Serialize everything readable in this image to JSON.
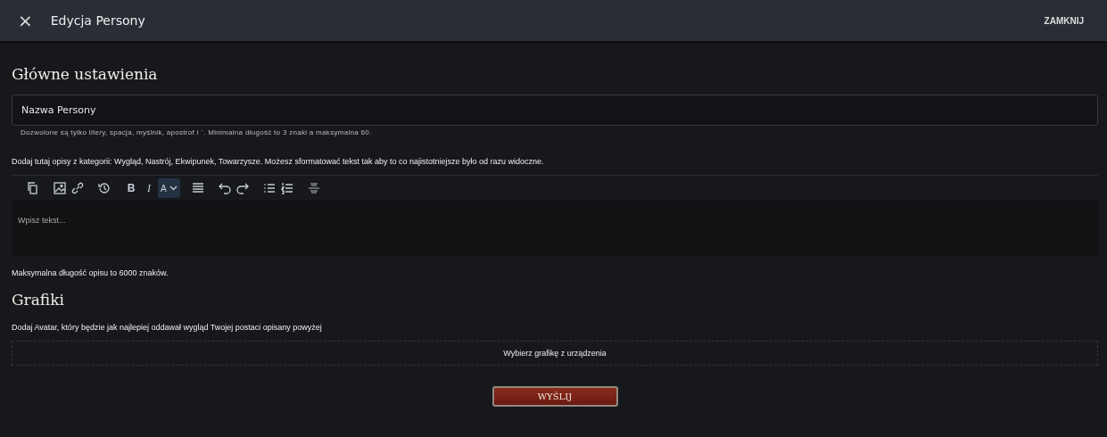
{
  "header": {
    "close_icon": "×",
    "title": "Edycja Persony",
    "action": "ZAMKNIJ"
  },
  "main_settings": {
    "heading": "Główne ustawienia",
    "name_field": {
      "placeholder": "Nazwa Persony",
      "hint": "Dozwolone są tylko litery, spacja, myślnik, apostrof i `. Minimalna długość to 3 znaki a maksymalna 60."
    },
    "description_intro": "Dodaj tutaj opisy z kategorii: Wygląd, Nastrój, Ekwipunek, Towarzysze. Możesz sformatować tekst tak aby to co najistotniejsze było od razu widoczne.",
    "toolbar": [
      {
        "kind": "copy",
        "selected": false
      },
      {
        "kind": "image",
        "selected": false
      },
      {
        "kind": "link",
        "selected": false
      },
      {
        "kind": "history",
        "selected": false
      },
      {
        "kind": "bold",
        "label": "B",
        "selected": false
      },
      {
        "kind": "italic",
        "label": "I",
        "selected": false
      },
      {
        "kind": "color",
        "label": "A",
        "selected": true
      },
      {
        "kind": "align",
        "selected": false
      },
      {
        "kind": "undo",
        "selected": false
      },
      {
        "kind": "redo",
        "selected": false
      },
      {
        "kind": "bullets",
        "selected": false
      },
      {
        "kind": "numbers",
        "selected": false
      },
      {
        "kind": "format",
        "selected": false
      }
    ],
    "editor": {
      "placeholder": "Wpisz tekst..."
    },
    "max_length_note": "Maksymalna długość opisu to 6000 znaków."
  },
  "graphics": {
    "heading": "Grafiki",
    "intro": "Dodaj Avatar, który będzie jak najlepiej oddawał wygląd Twojej postaci opisany powyżej",
    "upload": "Wybierz grafikę z urządzenia"
  },
  "submit": "WYŚLIJ"
}
